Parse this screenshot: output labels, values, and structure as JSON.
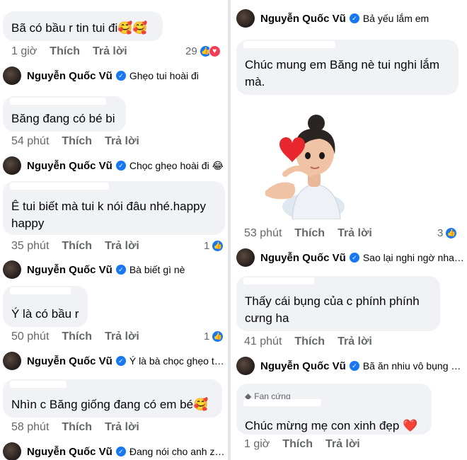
{
  "left": {
    "c1": {
      "text": "Bã có bầu r tin tui đi",
      "emoji": "🥰🥰",
      "time": "1 giờ",
      "like": "Thích",
      "reply": "Trả lời",
      "count": "29"
    },
    "r1": {
      "name": "Nguyễn Quốc Vũ",
      "text": "Ghẹo tui hoài đi"
    },
    "c2": {
      "text": "Băng đang có bé bi",
      "time": "54 phút",
      "like": "Thích",
      "reply": "Trả lời"
    },
    "r2": {
      "name": "Nguyễn Quốc Vũ",
      "text": "Chọc ghẹo hoài đi 😂"
    },
    "c3": {
      "line1": "Ê tui biết mà tui k nói đâu nhé.happy",
      "line2": "happy",
      "time": "35 phút",
      "like": "Thích",
      "reply": "Trả lời",
      "count": "1"
    },
    "r3": {
      "name": "Nguyễn Quốc Vũ",
      "text": "Bà biết gì nè"
    },
    "c4": {
      "text": "Ý là có bầu r",
      "time": "50 phút",
      "like": "Thích",
      "reply": "Trả lời",
      "count": "1"
    },
    "r4": {
      "name": "Nguyễn Quốc Vũ",
      "text": "Ý là bà chọc ghẹo tôi ..."
    },
    "c5": {
      "text": "Nhìn c Băng giống đang có em bé",
      "emoji": "🥰",
      "time": "58 phút",
      "like": "Thích",
      "reply": "Trả lời"
    },
    "r5": {
      "name": "Nguyễn Quốc Vũ",
      "text": "Đang nói cho anh zui ..."
    }
  },
  "right": {
    "r0": {
      "name": "Nguyễn Quốc Vũ",
      "text": "Bả yếu lắm em"
    },
    "c1": {
      "line1": "Chúc mung em Băng nè tui nghi lắm",
      "line2": "mà."
    },
    "c2": {
      "time": "53 phút",
      "like": "Thích",
      "reply": "Trả lời",
      "count": "3"
    },
    "r1": {
      "name": "Nguyễn Quốc Vũ",
      "text": "Sao lại nghi ngờ nhau..."
    },
    "c3": {
      "line1": "Thấy cái bụng của c phính phính",
      "line2": "cưng ha",
      "time": "41 phút",
      "like": "Thích",
      "reply": "Trả lời"
    },
    "r2": {
      "name": "Nguyễn Quốc Vũ",
      "text": "Bã ăn nhiu vô bụng h..."
    },
    "c4": {
      "badge": "Fan cứng",
      "text": "Chúc mừng mẹ con xinh đẹp",
      "emoji": "❤️",
      "time": "1 giờ",
      "like": "Thích",
      "reply": "Trả lời"
    }
  },
  "icons": {
    "verified": "verified-badge-icon",
    "like": "like-reaction-icon",
    "love": "love-reaction-icon",
    "fan": "diamond-icon"
  },
  "colors": {
    "bubble": "#f0f2f5",
    "meta": "#65676b",
    "verified": "#1877f2",
    "love": "#f33e58"
  }
}
